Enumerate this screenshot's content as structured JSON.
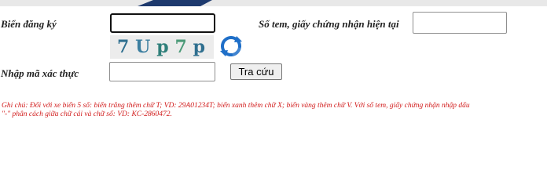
{
  "form": {
    "plate_label": "Biển đăng ký",
    "plate_value": "",
    "sticker_label": "Số tem, giấy chứng nhận hiện tại",
    "sticker_value": "",
    "captcha_label": "Nhập mã xác thực",
    "captcha_value": "",
    "captcha_chars": [
      "7",
      "U",
      "p",
      "7",
      "p"
    ],
    "captcha_colors": [
      "#2f6f8f",
      "#3c7fa0",
      "#2f7f7a",
      "#4b9a78",
      "#2f6f8f"
    ],
    "search_label": "Tra cứu"
  },
  "note": {
    "text": "Ghi chú: Đối với xe biển 5 số: biển trắng thêm chữ T; VD: 29A01234T; biển xanh thêm chữ X; biển vàng thêm chữ V. Với số tem, giấy chứng nhận nhập dấu \"-\" phân cách giữa chữ cái và chữ số: VD: KC-2860472."
  },
  "colors": {
    "note": "#d11a1a",
    "refresh_icon": "#1f6fc8"
  }
}
